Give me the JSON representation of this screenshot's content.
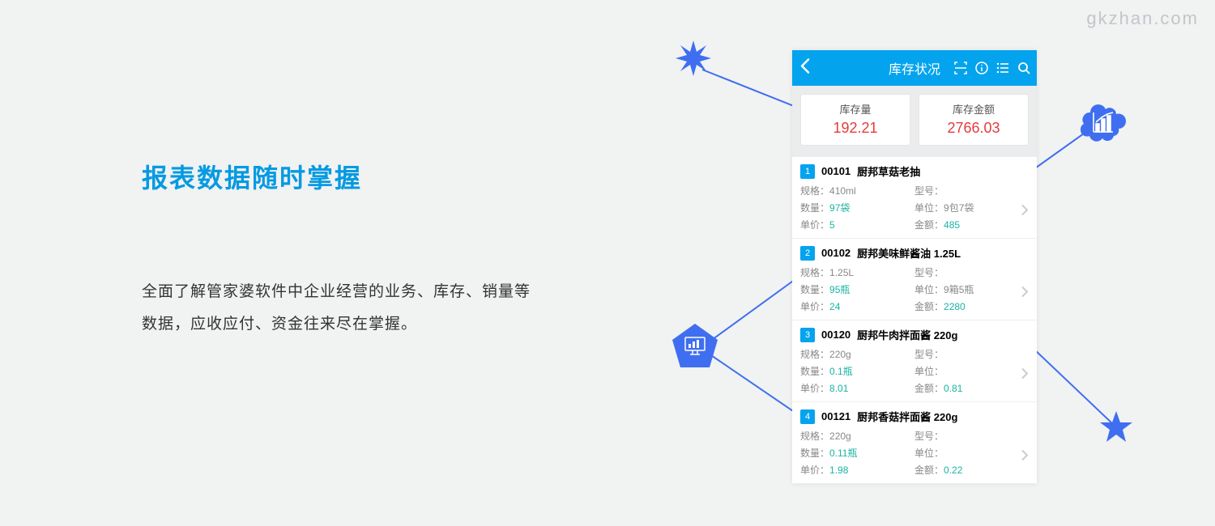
{
  "watermark": "gkzhan.com",
  "left": {
    "heading": "报表数据随时掌握",
    "desc": "全面了解管家婆软件中企业经营的业务、库存、销量等数据，应收应付、资金往来尽在掌握。"
  },
  "phone": {
    "title": "库存状况",
    "summary": {
      "stock_label": "库存量",
      "stock_value": "192.21",
      "amount_label": "库存金额",
      "amount_value": "2766.03"
    },
    "field_labels": {
      "spec": "规格：",
      "model": "型号：",
      "qty": "数量：",
      "unit": "单位：",
      "price": "单价：",
      "amount": "金额："
    },
    "items": [
      {
        "idx": "1",
        "code": "00101",
        "name": "厨邦草菇老抽",
        "spec": "410ml",
        "model": "",
        "qty": "97袋",
        "unit": "9包7袋",
        "price": "5",
        "amount": "485"
      },
      {
        "idx": "2",
        "code": "00102",
        "name": "厨邦美味鲜酱油 1.25L",
        "spec": "1.25L",
        "model": "",
        "qty": "95瓶",
        "unit": "9箱5瓶",
        "price": "24",
        "amount": "2280"
      },
      {
        "idx": "3",
        "code": "00120",
        "name": "厨邦牛肉拌面酱 220g",
        "spec": "220g",
        "model": "",
        "qty": "0.1瓶",
        "unit": "",
        "price": "8.01",
        "amount": "0.81"
      },
      {
        "idx": "4",
        "code": "00121",
        "name": "厨邦香菇拌面酱 220g",
        "spec": "220g",
        "model": "",
        "qty": "0.11瓶",
        "unit": "",
        "price": "1.98",
        "amount": "0.22"
      }
    ]
  }
}
